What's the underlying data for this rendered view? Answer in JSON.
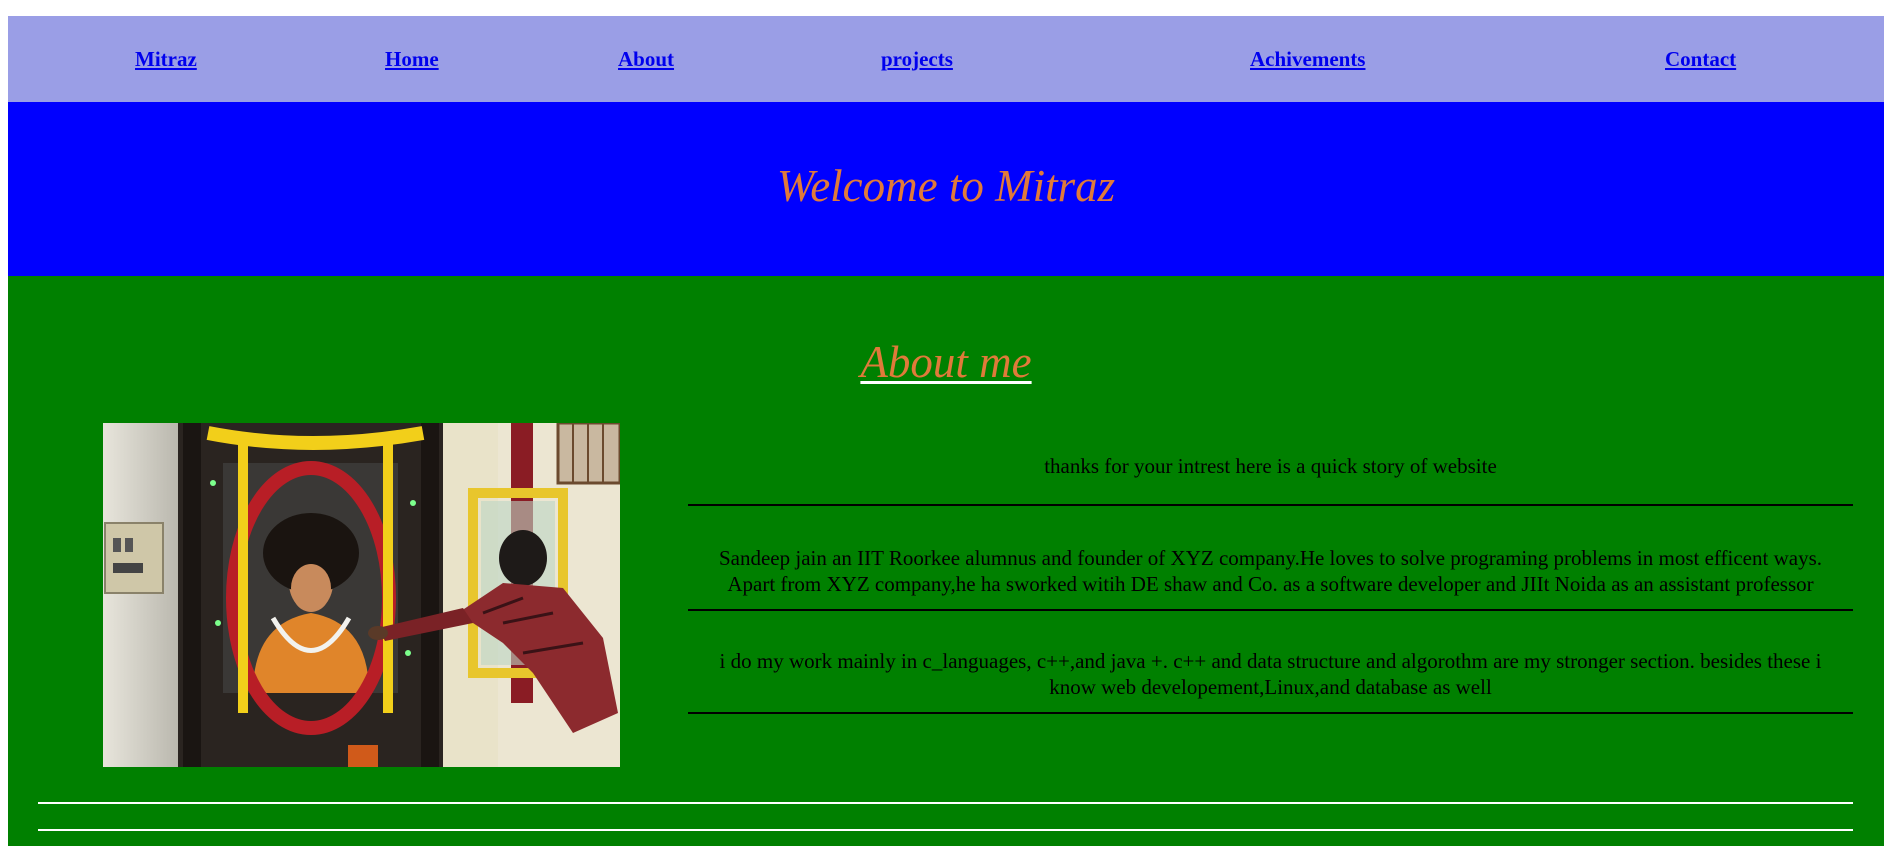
{
  "nav": {
    "items": [
      {
        "label": "Mitraz"
      },
      {
        "label": "Home"
      },
      {
        "label": "About"
      },
      {
        "label": "projects"
      },
      {
        "label": "Achivements"
      },
      {
        "label": "Contact"
      }
    ],
    "bg_color": "#9a9ee6",
    "link_color": "#0000ee"
  },
  "hero": {
    "title": "Welcome to Mitraz",
    "bg_color": "#0000ff",
    "title_color": "#e07a3a"
  },
  "about": {
    "heading": "About me",
    "bg_color": "#008000",
    "paragraphs": [
      "thanks for your intrest here is a quick story of website",
      "Sandeep jain an IIT Roorkee alumnus and founder of XYZ company.He loves to solve programing problems in most efficent ways. Apart from XYZ company,he ha sworked witih DE shaw and Co. as a software developer and JIIt Noida as an assistant professor",
      "i do my work mainly in c_languages, c++,and java +. c++ and data structure and algorothm are my stronger section. besides these i know web developement,Linux,and database as well"
    ]
  }
}
